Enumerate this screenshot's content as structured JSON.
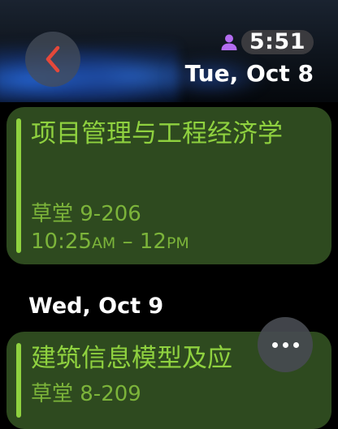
{
  "header": {
    "time": "5:51",
    "date": "Tue, Oct 8",
    "icons": {
      "back": "chevron-left-icon",
      "user": "person-icon"
    },
    "colors": {
      "back_chevron": "#e5483a",
      "user_icon": "#b36cf0"
    }
  },
  "events": [
    {
      "title": "项目管理与工程经济学",
      "location": "草堂 9-206",
      "time_start": "10:25",
      "time_start_suffix": "AM",
      "time_sep": " – ",
      "time_end": "12",
      "time_end_suffix": "PM"
    },
    {
      "title": "建筑信息模型及应",
      "location": "草堂 8-209"
    }
  ],
  "day_heading": "Wed, Oct 9",
  "more_button": {
    "icon": "ellipsis-icon"
  },
  "colors": {
    "accent_green": "#8fd13f",
    "card_background": "#2e4a1f"
  }
}
